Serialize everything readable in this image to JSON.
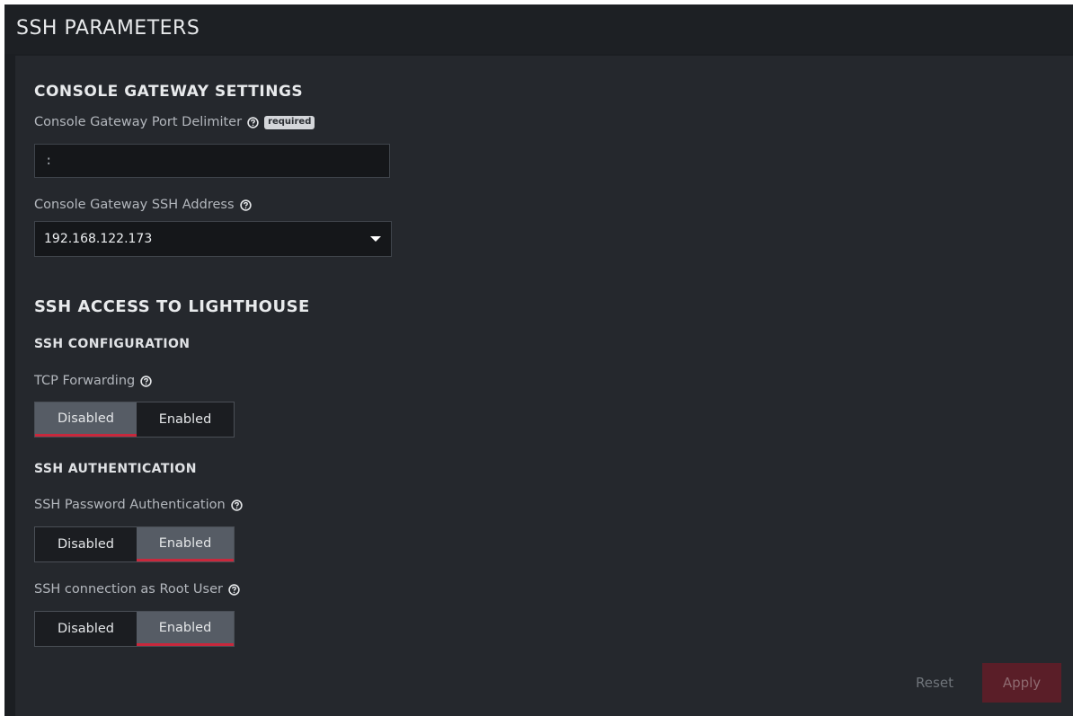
{
  "header": {
    "title": "SSH PARAMETERS"
  },
  "console_gateway": {
    "title": "CONSOLE GATEWAY SETTINGS",
    "port_delimiter": {
      "label": "Console Gateway Port Delimiter",
      "badge": "required",
      "value": ":"
    },
    "ssh_address": {
      "label": "Console Gateway SSH Address",
      "selected": "192.168.122.173"
    }
  },
  "ssh_access": {
    "title": "SSH ACCESS TO LIGHTHOUSE",
    "configuration": {
      "title": "SSH CONFIGURATION",
      "tcp_forwarding": {
        "label": "TCP Forwarding",
        "options": [
          "Disabled",
          "Enabled"
        ],
        "selected": "Disabled"
      }
    },
    "authentication": {
      "title": "SSH AUTHENTICATION",
      "password_auth": {
        "label": "SSH Password Authentication",
        "options": [
          "Disabled",
          "Enabled"
        ],
        "selected": "Enabled"
      },
      "root_user": {
        "label": "SSH connection as Root User",
        "options": [
          "Disabled",
          "Enabled"
        ],
        "selected": "Enabled"
      }
    }
  },
  "footer": {
    "reset_label": "Reset",
    "apply_label": "Apply"
  },
  "colors": {
    "accent": "#c8283c",
    "apply_disabled": "#5a1e28",
    "background": "#25282d"
  },
  "icons": {
    "help": "question-circle-icon",
    "dropdown": "caret-down-icon"
  }
}
